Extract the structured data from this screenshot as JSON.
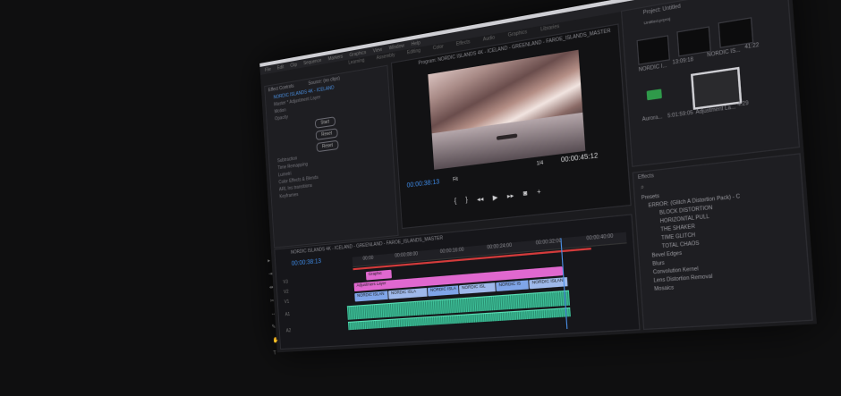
{
  "menu": [
    "File",
    "Edit",
    "Clip",
    "Sequence",
    "Markers",
    "Graphics",
    "View",
    "Window",
    "Help"
  ],
  "workspaces": [
    "Learning",
    "Assembly",
    "Editing",
    "Color",
    "Effects",
    "Audio",
    "Graphics",
    "Libraries"
  ],
  "project": {
    "title": "Project: Untitled",
    "file": "Untitled.prproj",
    "items": [
      {
        "name": "NORDIC I...",
        "duration": "13:09:18"
      },
      {
        "name": "NORDIC IS...",
        "duration": "41:22"
      },
      {
        "name": "Aurora...",
        "duration": "5:01:59:05"
      },
      {
        "name": "Adjustment La...",
        "duration": "4:29"
      }
    ]
  },
  "source": {
    "tabs": [
      "Effect Controls",
      "Source: (no clips)"
    ],
    "sequence_label": "NORDIC ISLANDS 4K - ICELAND",
    "rows": [
      "Master * Adjustment Layer",
      "Motion",
      "Opacity",
      "Subtraction",
      "Time Remapping",
      "Lumetri",
      "Color Effects & Blends",
      "ARL Ins transitions",
      "Keyframes"
    ],
    "buttons": [
      "Start",
      "Reset",
      "Reset"
    ]
  },
  "program": {
    "title": "Program: NORDIC ISLANDS 4K - ICELAND - GREENLAND - FAROE_ISLANDS_MASTER",
    "timecode_current": "00:00:38:13",
    "timecode_total": "00:00:45:12",
    "fit": "Fit",
    "fraction": "1/4"
  },
  "timeline": {
    "sequence_tab": "NORDIC ISLANDS 4K - ICELAND - GREENLAND - FAROE_ISLANDS_MASTER",
    "timecode": "00:00:38:13",
    "ruler": [
      "00:00",
      "00:00:08:00",
      "00:00:16:00",
      "00:00:24:00",
      "00:00:32:00",
      "00:00:40:00"
    ],
    "clips_v3": "Graphic",
    "clips_v2": "Adjustment Layer",
    "clips_v1": [
      "NORDIC ISLAN",
      "NORDIC ISLA",
      "NORDIC ISLA",
      "NORDIC ISL",
      "NORDIC IS",
      "NORDIC ISLAN"
    ],
    "tracks": [
      "V3",
      "V2",
      "V1",
      "A1",
      "A2"
    ]
  },
  "effects": {
    "title": "Effects",
    "items": [
      {
        "label": "Presets",
        "level": 0
      },
      {
        "label": "ERROR: (Glitch A Distortion Pack) - C",
        "level": 1
      },
      {
        "label": "BLOCK DISTORTION",
        "level": 2
      },
      {
        "label": "HORIZONTAL PULL",
        "level": 2
      },
      {
        "label": "THE SHAKER",
        "level": 2
      },
      {
        "label": "TIME GLITCH",
        "level": 2
      },
      {
        "label": "TOTAL CHAOS",
        "level": 2
      },
      {
        "label": "Bevel Edges",
        "level": 1
      },
      {
        "label": "Blurs",
        "level": 1
      },
      {
        "label": "Convolution Kernel",
        "level": 1
      },
      {
        "label": "Lens Distortion Removal",
        "level": 1
      },
      {
        "label": "Mosaics",
        "level": 1
      }
    ]
  },
  "colors": {
    "accent_blue": "#3e8ae6",
    "clip_pink": "#e068cf",
    "clip_blue": "#7fa5e8",
    "audio_green": "#3ec29a",
    "workbar_red": "#d43b3b"
  }
}
